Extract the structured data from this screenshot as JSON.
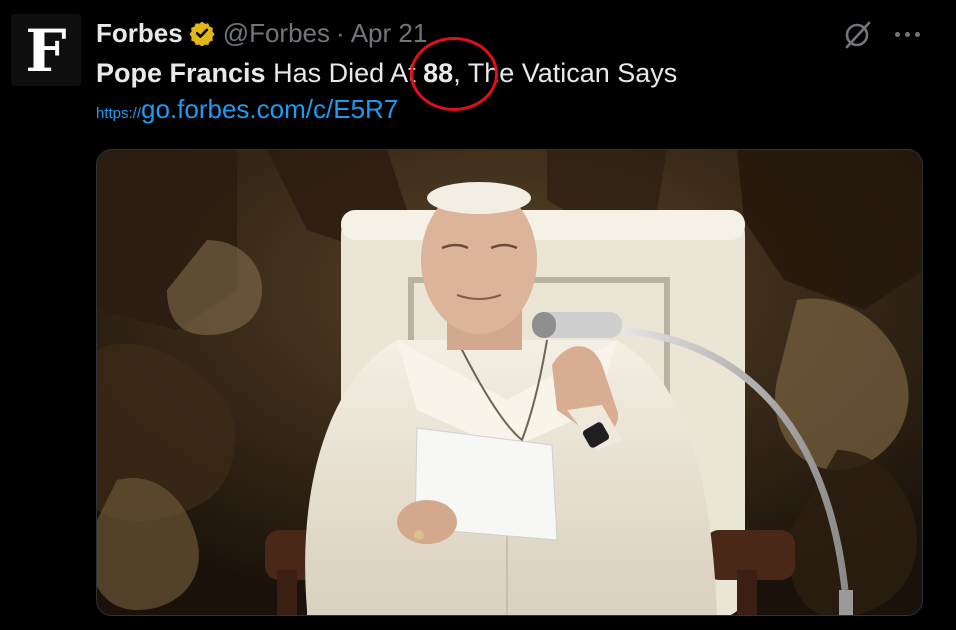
{
  "tweet": {
    "author_name": "Forbes",
    "handle": "@Forbes",
    "separator": "·",
    "date": "Apr 21",
    "avatar_letter": "F",
    "headline_bold": "Pope Francis",
    "headline_mid": " Has Died At ",
    "headline_num": "88",
    "headline_end": ", The Vatican Says",
    "link_prefix": "https://",
    "link_path": "go.forbes.com/c/E5R7"
  },
  "colors": {
    "background": "#000000",
    "text": "#e7e9ea",
    "muted": "#71767b",
    "link": "#1d9bf0",
    "verified_gold": "#e2b719",
    "annotation_red": "#e0101a"
  },
  "icons": {
    "verified": "verified-badge-icon",
    "grok": "grok-icon",
    "more": "more-options-icon"
  }
}
